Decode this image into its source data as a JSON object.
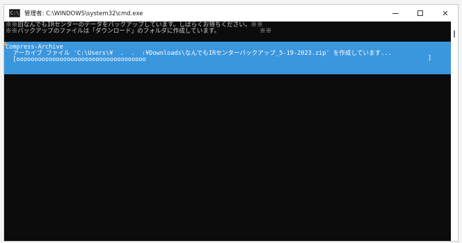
{
  "window": {
    "title": "管理者: C:\\WINDOWS\\system32\\cmd.exe",
    "icon_label": "C:\\",
    "icon": "console-app-icon",
    "controls": {
      "minimize_icon": "minimize-icon",
      "maximize_icon": "maximize-icon",
      "close_label": "✕"
    }
  },
  "console": {
    "lines": [
      "※※旧なんでもIRセンターのデータをバックアップしています。しばらくお待ちください。※※",
      "※※バックアップのファイルは「ダウンロード」のフォルダに作成しています。           ※※"
    ],
    "progress": {
      "activity": "Compress-Archive",
      "status": "  アーカイブ ファイル 'C:\\Users\\¥  .  .  :¥Downloads\\なんでもIRセンターバックアップ_5-19-2023.zip' を作成しています...",
      "bar": "  [oooooooooooooooooooooooooooooooooooo",
      "bar_end": "]"
    }
  },
  "colors": {
    "console_bg": "#0c0c0c",
    "console_fg": "#cccccc",
    "progress_bg": "#3a96dd",
    "progress_fg": "#ffffff"
  }
}
